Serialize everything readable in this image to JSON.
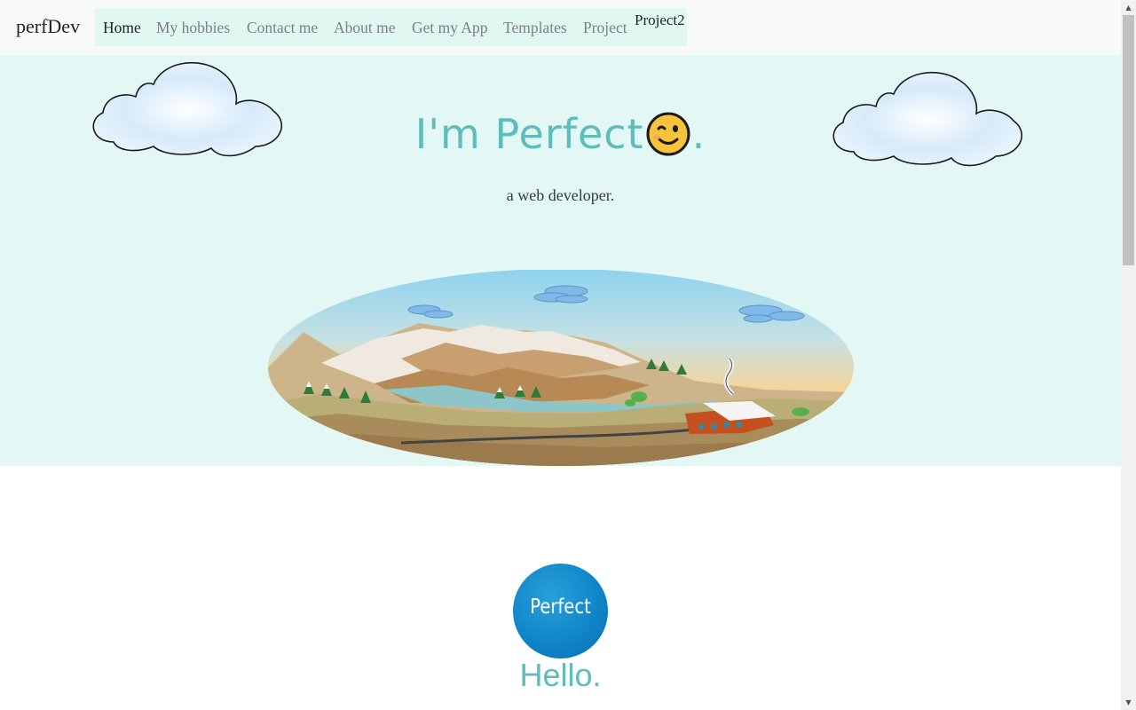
{
  "navbar": {
    "brand": "perfDev",
    "links": [
      "Home",
      "My hobbies",
      "Contact me",
      "About me",
      "Get my App",
      "Templates",
      "Project",
      "Project2"
    ],
    "active": "Home"
  },
  "hero": {
    "title_text": "I'm Perfect",
    "title_suffix": ".",
    "emoji_icon": "winking-face-icon",
    "subtitle": "a web developer.",
    "accent_color": "#5fbcbc",
    "background_color": "#e3f8f4"
  },
  "profile": {
    "avatar_text": "Perfect",
    "greeting": "Hello."
  },
  "scrollbar": {
    "up_icon": "▲",
    "down_icon": "▼"
  }
}
